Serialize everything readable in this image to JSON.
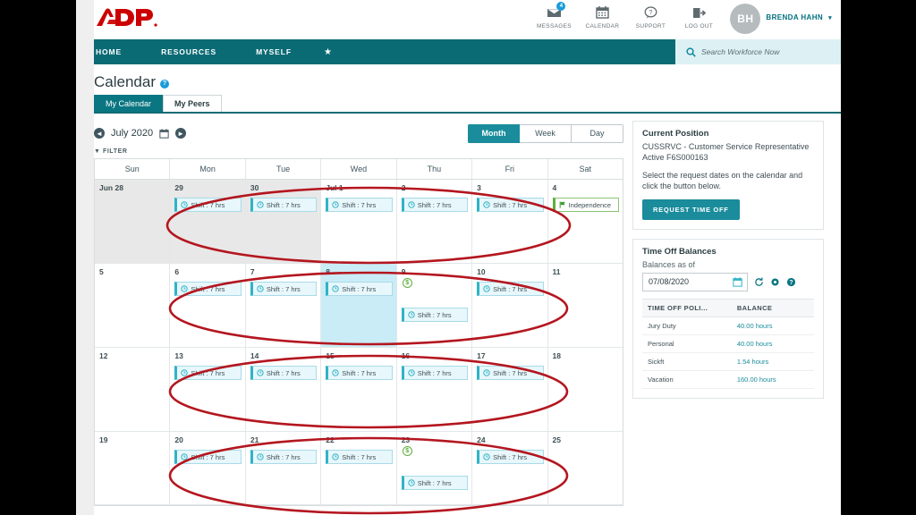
{
  "brand": {
    "logo_text": "ADP",
    "accent": "#0a6b75",
    "teal": "#1a8c9c",
    "annotation_color": "#b4161f"
  },
  "topbar": {
    "icons": [
      {
        "name": "messages",
        "label": "MESSAGES",
        "badge": "4"
      },
      {
        "name": "calendar",
        "label": "CALENDAR",
        "badge": ""
      },
      {
        "name": "support",
        "label": "SUPPORT",
        "badge": ""
      },
      {
        "name": "logout",
        "label": "LOG OUT",
        "badge": ""
      }
    ],
    "avatar_initials": "BH",
    "user_name": "BRENDA HAHN"
  },
  "nav": {
    "items": [
      {
        "label": "HOME"
      },
      {
        "label": "RESOURCES"
      },
      {
        "label": "MYSELF"
      }
    ],
    "star_glyph": "★",
    "search_placeholder": "Search Workforce Now"
  },
  "page": {
    "title": "Calendar",
    "help_glyph": "?"
  },
  "tabs": [
    {
      "label": "My Calendar",
      "active": true
    },
    {
      "label": "My Peers",
      "active": false
    }
  ],
  "toolbar": {
    "prev_glyph": "◄",
    "next_glyph": "►",
    "month_label": "July 2020",
    "filter_label": "FILTER",
    "views": [
      {
        "label": "Month",
        "active": true
      },
      {
        "label": "Week",
        "active": false
      },
      {
        "label": "Day",
        "active": false
      }
    ]
  },
  "calendar": {
    "day_headers": [
      "Sun",
      "Mon",
      "Tue",
      "Wed",
      "Thu",
      "Fri",
      "Sat"
    ],
    "shift_label": "Shift : 7 hrs",
    "weeks": [
      [
        {
          "num": "Jun 28",
          "other": true,
          "selected": false,
          "pay": false,
          "events": []
        },
        {
          "num": "29",
          "other": true,
          "selected": false,
          "pay": false,
          "events": [
            {
              "type": "shift",
              "label": "Shift : 7 hrs"
            }
          ]
        },
        {
          "num": "30",
          "other": true,
          "selected": false,
          "pay": false,
          "events": [
            {
              "type": "shift",
              "label": "Shift : 7 hrs"
            }
          ]
        },
        {
          "num": "Jul 1",
          "other": false,
          "selected": false,
          "pay": false,
          "events": [
            {
              "type": "shift",
              "label": "Shift : 7 hrs"
            }
          ]
        },
        {
          "num": "2",
          "other": false,
          "selected": false,
          "pay": false,
          "events": [
            {
              "type": "shift",
              "label": "Shift : 7 hrs"
            }
          ]
        },
        {
          "num": "3",
          "other": false,
          "selected": false,
          "pay": false,
          "events": [
            {
              "type": "shift",
              "label": "Shift : 7 hrs"
            }
          ]
        },
        {
          "num": "4",
          "other": false,
          "selected": false,
          "pay": false,
          "events": [
            {
              "type": "holiday",
              "label": "Independence"
            }
          ]
        }
      ],
      [
        {
          "num": "5",
          "other": false,
          "selected": false,
          "pay": false,
          "events": []
        },
        {
          "num": "6",
          "other": false,
          "selected": false,
          "pay": false,
          "events": [
            {
              "type": "shift",
              "label": "Shift : 7 hrs"
            }
          ]
        },
        {
          "num": "7",
          "other": false,
          "selected": false,
          "pay": false,
          "events": [
            {
              "type": "shift",
              "label": "Shift : 7 hrs"
            }
          ]
        },
        {
          "num": "8",
          "other": false,
          "selected": true,
          "pay": false,
          "events": [
            {
              "type": "shift",
              "label": "Shift : 7 hrs"
            }
          ]
        },
        {
          "num": "9",
          "other": false,
          "selected": false,
          "pay": true,
          "events": [
            {
              "type": "shift",
              "label": "Shift : 7 hrs"
            }
          ]
        },
        {
          "num": "10",
          "other": false,
          "selected": false,
          "pay": false,
          "events": [
            {
              "type": "shift",
              "label": "Shift : 7 hrs"
            }
          ]
        },
        {
          "num": "11",
          "other": false,
          "selected": false,
          "pay": false,
          "events": []
        }
      ],
      [
        {
          "num": "12",
          "other": false,
          "selected": false,
          "pay": false,
          "events": []
        },
        {
          "num": "13",
          "other": false,
          "selected": false,
          "pay": false,
          "events": [
            {
              "type": "shift",
              "label": "Shift : 7 hrs"
            }
          ]
        },
        {
          "num": "14",
          "other": false,
          "selected": false,
          "pay": false,
          "events": [
            {
              "type": "shift",
              "label": "Shift : 7 hrs"
            }
          ]
        },
        {
          "num": "15",
          "other": false,
          "selected": false,
          "pay": false,
          "events": [
            {
              "type": "shift",
              "label": "Shift : 7 hrs"
            }
          ]
        },
        {
          "num": "16",
          "other": false,
          "selected": false,
          "pay": false,
          "events": [
            {
              "type": "shift",
              "label": "Shift : 7 hrs"
            }
          ]
        },
        {
          "num": "17",
          "other": false,
          "selected": false,
          "pay": false,
          "events": [
            {
              "type": "shift",
              "label": "Shift : 7 hrs"
            }
          ]
        },
        {
          "num": "18",
          "other": false,
          "selected": false,
          "pay": false,
          "events": []
        }
      ],
      [
        {
          "num": "19",
          "other": false,
          "selected": false,
          "pay": false,
          "events": []
        },
        {
          "num": "20",
          "other": false,
          "selected": false,
          "pay": false,
          "events": [
            {
              "type": "shift",
              "label": "Shift : 7 hrs"
            }
          ]
        },
        {
          "num": "21",
          "other": false,
          "selected": false,
          "pay": false,
          "events": [
            {
              "type": "shift",
              "label": "Shift : 7 hrs"
            }
          ]
        },
        {
          "num": "22",
          "other": false,
          "selected": false,
          "pay": false,
          "events": [
            {
              "type": "shift",
              "label": "Shift : 7 hrs"
            }
          ]
        },
        {
          "num": "23",
          "other": false,
          "selected": false,
          "pay": true,
          "events": [
            {
              "type": "shift",
              "label": "Shift : 7 hrs"
            }
          ]
        },
        {
          "num": "24",
          "other": false,
          "selected": false,
          "pay": false,
          "events": [
            {
              "type": "shift",
              "label": "Shift : 7 hrs"
            }
          ]
        },
        {
          "num": "25",
          "other": false,
          "selected": false,
          "pay": false,
          "events": []
        }
      ]
    ],
    "pay_badge_glyph": "$"
  },
  "side": {
    "position": {
      "heading": "Current Position",
      "line1": "CUSSRVC - Customer Service Representative",
      "line2": "Active F6S000163",
      "instruction": "Select the request dates on the calendar and click the button below.",
      "button_label": "REQUEST TIME OFF"
    },
    "balances": {
      "heading": "Time Off Balances",
      "as_of_label": "Balances as of",
      "as_of_date": "07/08/2020",
      "columns": [
        "TIME OFF POLI...",
        "BALANCE"
      ],
      "rows": [
        {
          "policy": "Jury Duty",
          "balance": "40.00 hours"
        },
        {
          "policy": "Personal",
          "balance": "40.00 hours"
        },
        {
          "policy": "Sickft",
          "balance": "1.54 hours"
        },
        {
          "policy": "Vacation",
          "balance": "160.00 hours"
        }
      ]
    }
  }
}
